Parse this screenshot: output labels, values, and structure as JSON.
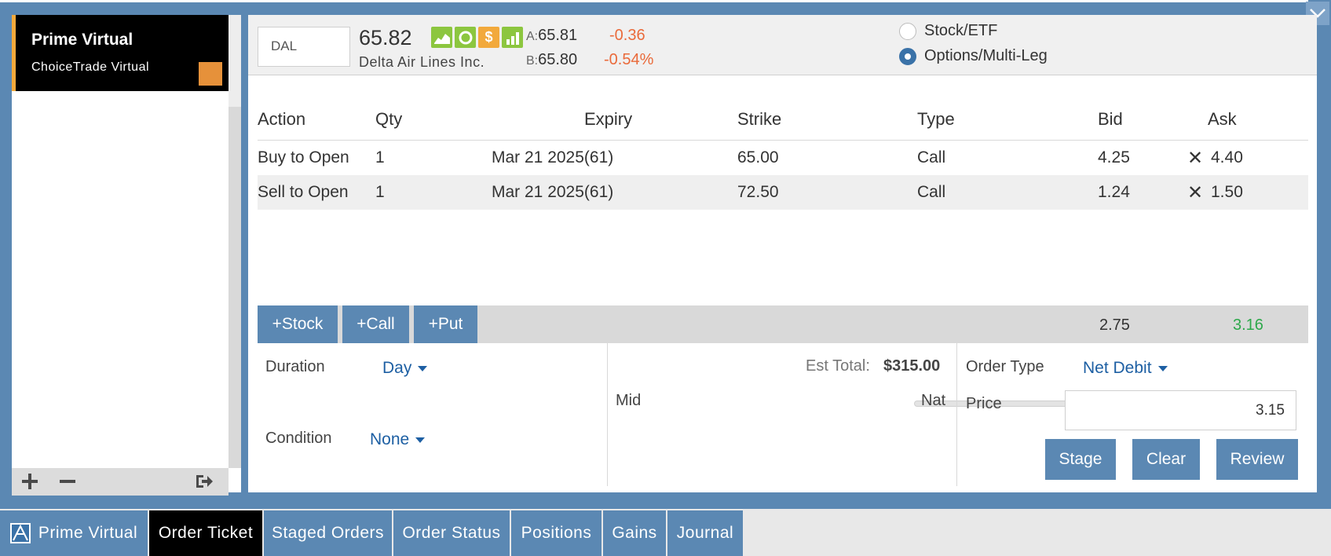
{
  "account": {
    "name": "Prime Virtual",
    "subtitle": "ChoiceTrade Virtual"
  },
  "quote": {
    "symbol": "DAL",
    "last": "65.82",
    "company": "Delta Air Lines Inc.",
    "ask_label": "A:",
    "ask": "65.81",
    "bid_label": "B:",
    "bid": "65.80",
    "change": "-0.36",
    "change_pct": "-0.54%",
    "icons": [
      "chart-icon",
      "circle-icon",
      "dollar-icon",
      "bars-icon"
    ],
    "dollar_glyph": "$"
  },
  "mode": {
    "stock_label": "Stock/ETF",
    "options_label": "Options/Multi-Leg",
    "selected": "Options/Multi-Leg"
  },
  "legs": {
    "headers": [
      "Action",
      "Qty",
      "Expiry",
      "Strike",
      "Type",
      "Bid",
      "Ask"
    ],
    "rows": [
      {
        "action": "Buy to Open",
        "qty": "1",
        "expiry": "Mar 21 2025(61)",
        "strike": "65.00",
        "type": "Call",
        "bid": "4.25",
        "ask": "4.40"
      },
      {
        "action": "Sell to Open",
        "qty": "1",
        "expiry": "Mar 21 2025(61)",
        "strike": "72.50",
        "type": "Call",
        "bid": "1.24",
        "ask": "1.50"
      }
    ],
    "remove_glyph": "✕"
  },
  "add_buttons": {
    "stock": "+Stock",
    "call": "+Call",
    "put": "+Put"
  },
  "totals": {
    "bid": "2.75",
    "ask": "3.16"
  },
  "order": {
    "duration_label": "Duration",
    "duration_value": "Day",
    "condition_label": "Condition",
    "condition_value": "None",
    "est_total_label": "Est Total:",
    "est_total_value": "$315.00",
    "slider_left": "Mid",
    "slider_right": "Nat",
    "slider_value": 0.93,
    "order_type_label": "Order Type",
    "order_type_value": "Net Debit",
    "price_label": "Price",
    "price_value": "3.15",
    "stage": "Stage",
    "clear": "Clear",
    "review": "Review"
  },
  "tabs": [
    "Prime Virtual",
    "Order Ticket",
    "Staged Orders",
    "Order Status",
    "Positions",
    "Gains",
    "Journal"
  ],
  "active_tab": "Order Ticket",
  "colors": {
    "accent": "#5b88b3",
    "buy": "#2ca84a",
    "sell": "#ea6a3a",
    "link": "#1d5fa3"
  }
}
